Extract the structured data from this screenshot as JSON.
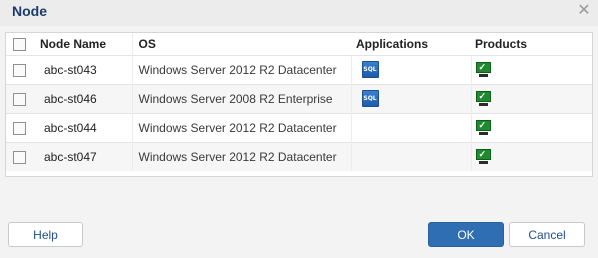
{
  "dialog": {
    "title": "Node",
    "close_glyph": "✕"
  },
  "table": {
    "headers": {
      "node_name": "Node Name",
      "os": "OS",
      "applications": "Applications",
      "products": "Products"
    },
    "rows": [
      {
        "node_name": "abc-st043",
        "os": "Windows Server 2012 R2 Datacenter",
        "applications": [
          "sql-server-icon"
        ],
        "products": [
          "monitor-check-icon"
        ]
      },
      {
        "node_name": "abc-st046",
        "os": "Windows Server 2008 R2 Enterprise",
        "applications": [
          "sql-server-icon"
        ],
        "products": [
          "monitor-check-icon"
        ]
      },
      {
        "node_name": "abc-st044",
        "os": "Windows Server 2012 R2 Datacenter",
        "applications": [],
        "products": [
          "monitor-check-icon"
        ]
      },
      {
        "node_name": "abc-st047",
        "os": "Windows Server 2012 R2 Datacenter",
        "applications": [],
        "products": [
          "monitor-check-icon"
        ]
      }
    ]
  },
  "buttons": {
    "help": "Help",
    "ok": "OK",
    "cancel": "Cancel"
  },
  "colors": {
    "title": "#1c3c6c",
    "primary_button": "#2f6eb3",
    "product_icon": "#1f8a30",
    "sql_icon": "#2a6fc0"
  }
}
